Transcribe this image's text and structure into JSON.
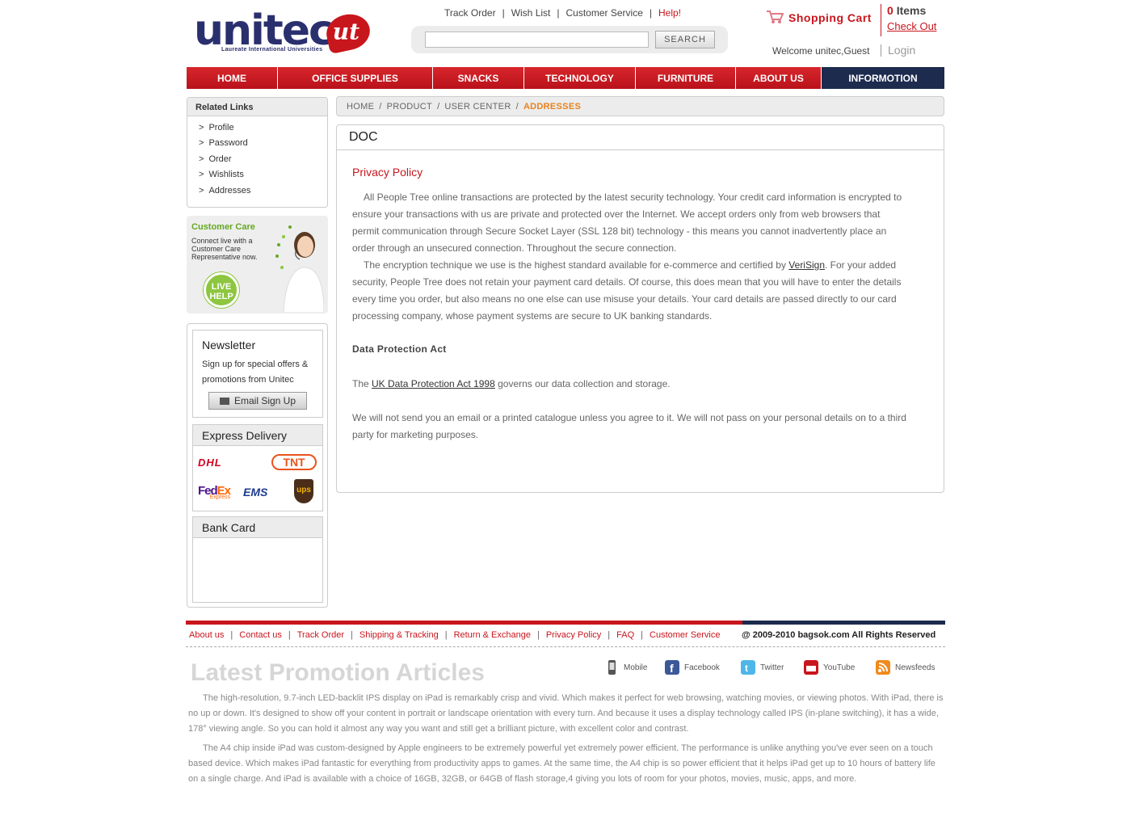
{
  "brand": {
    "name": "unitec",
    "badge": "ut",
    "tagline": "Laureate International Universities"
  },
  "top_links": {
    "track_order": "Track Order",
    "wish_list": "Wish List",
    "customer_service": "Customer Service",
    "help": "Help!",
    "sep": "|"
  },
  "search": {
    "value": "",
    "placeholder": "",
    "button": "SEARCH"
  },
  "cart": {
    "label": "Shopping Cart",
    "count": "0",
    "items_label": "Items",
    "checkout": "Check Out"
  },
  "user": {
    "welcome": "Welcome unitec,Guest",
    "login": "Login"
  },
  "nav": [
    {
      "label": "HOME"
    },
    {
      "label": "OFFICE SUPPLIES"
    },
    {
      "label": "SNACKS"
    },
    {
      "label": "TECHNOLOGY"
    },
    {
      "label": "FURNITURE"
    },
    {
      "label": "ABOUT US"
    },
    {
      "label": "INFORMOTION"
    }
  ],
  "related": {
    "title": "Related Links",
    "bullet": ">",
    "items": [
      "Profile",
      "Password",
      "Order",
      "Wishlists",
      "Addresses"
    ]
  },
  "customer_care": {
    "title": "Customer Care",
    "text": "Connect live with a Customer Care Representative now.",
    "live_help": "LIVE HELP"
  },
  "newsletter": {
    "title": "Newsletter",
    "text": "Sign up for special offers & promotions from Unitec",
    "button": "Email Sign Up"
  },
  "express": {
    "title": "Express Delivery",
    "carriers": [
      "DHL",
      "TNT",
      "FedEx",
      "Express",
      "EMS",
      "ups"
    ]
  },
  "bank": {
    "title": "Bank Card"
  },
  "breadcrumb": {
    "items": [
      "HOME",
      "PRODUCT",
      "USER CENTER"
    ],
    "current": "ADDRESSES",
    "sep": "/"
  },
  "doc": {
    "title": "DOC",
    "policy_title": "Privacy Policy",
    "para1": "All People Tree online transactions are protected by the latest security technology. Your credit card information is encrypted to ensure your transactions with us are private and protected over the Internet. We accept orders only from web browsers that permit communication through Secure Socket Layer (SSL 128 bit) technology - this means you cannot inadvertently place an order through an unsecured connection. Throughout the secure connection.",
    "para2_before": "The encryption technique we use is the highest standard available for e-commerce and certified by ",
    "para2_link": "VeriSign",
    "para2_after": ". For your added security, People Tree does not retain your payment card details. Of course, this does mean that you will have to enter the details every time you order, but also means no one else can use misuse your details. Your card details are passed directly to our card processing company, whose payment systems are secure to UK banking standards.",
    "dpa_title": "Data Protection Act",
    "dpa_before": "The ",
    "dpa_link": "UK Data Protection Act 1998",
    "dpa_after": " governs our data collection and storage.",
    "para4": "We will not send you an email or a printed catalogue unless you agree to it. We will not pass on your personal details on to a third party for marketing purposes."
  },
  "footer": {
    "links": [
      "About us",
      "Contact us",
      "Track Order",
      "Shipping & Tracking",
      "Return & Exchange",
      "Privacy Policy",
      "FAQ",
      "Customer Service"
    ],
    "sep": "|",
    "copyright": "@ 2009-2010 bagsok.com  All Rights Reserved"
  },
  "promo": {
    "title": "Latest Promotion Articles",
    "social": [
      "Mobile",
      "Facebook",
      "Twitter",
      "YouTube",
      "Newsfeeds"
    ],
    "para1": "The high-resolution, 9.7-inch LED-backlit IPS display on iPad is remarkably crisp and vivid. Which makes it perfect for web browsing, watching movies, or viewing photos. With iPad, there is no up or down. It's designed to show off your content in portrait or landscape orientation with every turn. And because it uses a display technology called IPS (in-plane switching), it has a wide, 178° viewing angle. So you can hold it almost any way you want and still get a brilliant picture, with excellent color and contrast.",
    "para2": "The A4 chip inside iPad was custom-designed by Apple engineers to be extremely powerful yet extremely power efficient. The performance is unlike anything you've ever seen on a touch based device. Which makes iPad fantastic for everything from productivity apps to games. At the same time, the A4 chip is so power efficient that it helps iPad get up to 10 hours of battery life on a single charge. And iPad is available with a choice of 16GB, 32GB, or 64GB of flash storage,4 giving you lots of room for your photos, movies, music, apps, and more."
  },
  "colors": {
    "brand_red": "#c8161d",
    "navy": "#1c2b4e",
    "accent_orange": "#e8821c",
    "care_green": "#66a823"
  }
}
